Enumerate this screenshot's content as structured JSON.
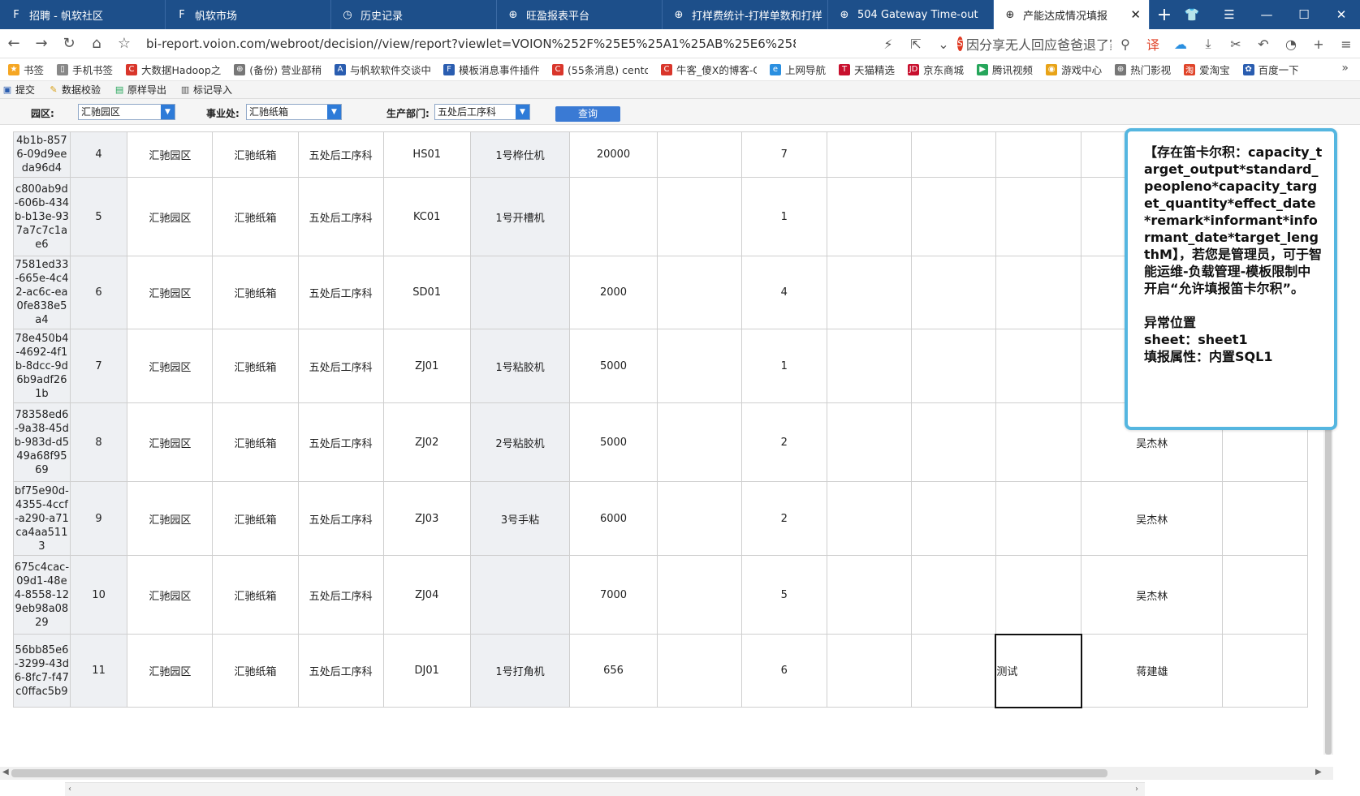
{
  "tabs": [
    {
      "label": "招聘 - 帆软社区",
      "icon": "F",
      "active": false
    },
    {
      "label": "帆软市场",
      "icon": "F",
      "active": false
    },
    {
      "label": "历史记录",
      "icon": "◷",
      "active": false
    },
    {
      "label": "旺盈报表平台",
      "icon": "⊕",
      "active": false
    },
    {
      "label": "打样费统计-打样单数和打样",
      "icon": "⊕",
      "active": false
    },
    {
      "label": "504 Gateway Time-out",
      "icon": "⊕",
      "active": false
    },
    {
      "label": "产能达成情况填报",
      "icon": "⊕",
      "active": true
    }
  ],
  "address": {
    "url": "bi-report.voion.com/webroot/decision//view/report?viewlet=VOION%252F%25E5%25A1%25AB%25E6%258A%25A5%",
    "news": "因分享无人回应爸爸退了家庭群"
  },
  "bookmarks": [
    {
      "label": "书签",
      "icon": "★",
      "color": "#f5a623"
    },
    {
      "label": "手机书签",
      "icon": "▯",
      "color": "#888888"
    },
    {
      "label": "大数据Hadoop之",
      "icon": "C",
      "color": "#d9362b"
    },
    {
      "label": "(备份) 营业部稍",
      "icon": "⊕",
      "color": "#777777"
    },
    {
      "label": "与帆软软件交谈中",
      "icon": "A",
      "color": "#2a5db0"
    },
    {
      "label": "模板消息事件插件",
      "icon": "F",
      "color": "#2a5db0"
    },
    {
      "label": "(55条消息) cento",
      "icon": "C",
      "color": "#d9362b"
    },
    {
      "label": "牛客_傻X的博客-C",
      "icon": "C",
      "color": "#d9362b"
    },
    {
      "label": "上网导航",
      "icon": "e",
      "color": "#2a8fe0"
    },
    {
      "label": "天猫精选",
      "icon": "T",
      "color": "#c8102e"
    },
    {
      "label": "京东商城",
      "icon": "JD",
      "color": "#c8102e"
    },
    {
      "label": "腾讯视频",
      "icon": "▶",
      "color": "#26a65b"
    },
    {
      "label": "游戏中心",
      "icon": "◉",
      "color": "#e8a317"
    },
    {
      "label": "热门影视",
      "icon": "⊕",
      "color": "#777777"
    },
    {
      "label": "爱淘宝",
      "icon": "淘",
      "color": "#e0442a"
    },
    {
      "label": "百度一下",
      "icon": "✿",
      "color": "#2a5db0"
    }
  ],
  "toolbar": {
    "submit": "提交",
    "validate": "数据校验",
    "export": "原样导出",
    "import": "标记导入"
  },
  "params": {
    "park_label": "园区:",
    "park_value": "汇驰园区",
    "division_label": "事业处:",
    "division_value": "汇驰纸箱",
    "dept_label": "生产部门:",
    "dept_value": "五处后工序科",
    "query_label": "查询"
  },
  "rows": [
    {
      "uuid": "4b1b-8576-09d9eeda96d4",
      "no": "4",
      "park": "汇驰园区",
      "division": "汇驰纸箱",
      "dept": "五处后工序科",
      "code": "HS01",
      "machine": "1号桦仕机",
      "target": "20000",
      "people": "7",
      "remark": "",
      "informant": ""
    },
    {
      "uuid": "c800ab9d-606b-434b-b13e-937a7c7c1ae6",
      "no": "5",
      "park": "汇驰园区",
      "division": "汇驰纸箱",
      "dept": "五处后工序科",
      "code": "KC01",
      "machine": "1号开槽机",
      "target": "",
      "people": "1",
      "remark": "",
      "informant": ""
    },
    {
      "uuid": "7581ed33-665e-4c42-ac6c-ea0fe838e5a4",
      "no": "6",
      "park": "汇驰园区",
      "division": "汇驰纸箱",
      "dept": "五处后工序科",
      "code": "SD01",
      "machine": "",
      "target": "2000",
      "people": "4",
      "remark": "",
      "informant": ""
    },
    {
      "uuid": "78e450b4-4692-4f1b-8dcc-9d6b9adf261b",
      "no": "7",
      "park": "汇驰园区",
      "division": "汇驰纸箱",
      "dept": "五处后工序科",
      "code": "ZJ01",
      "machine": "1号粘胶机",
      "target": "5000",
      "people": "1",
      "remark": "",
      "informant": ""
    },
    {
      "uuid": "78358ed6-9a38-45db-983d-d549a68f9569",
      "no": "8",
      "park": "汇驰园区",
      "division": "汇驰纸箱",
      "dept": "五处后工序科",
      "code": "ZJ02",
      "machine": "2号粘胶机",
      "target": "5000",
      "people": "2",
      "remark": "",
      "informant": "吴杰林"
    },
    {
      "uuid": "bf75e90d-4355-4ccf-a290-a71ca4aa5113",
      "no": "9",
      "park": "汇驰园区",
      "division": "汇驰纸箱",
      "dept": "五处后工序科",
      "code": "ZJ03",
      "machine": "3号手粘",
      "target": "6000",
      "people": "2",
      "remark": "",
      "informant": "吴杰林"
    },
    {
      "uuid": "675c4cac-09d1-48e4-8558-129eb98a0829",
      "no": "10",
      "park": "汇驰园区",
      "division": "汇驰纸箱",
      "dept": "五处后工序科",
      "code": "ZJ04",
      "machine": "",
      "target": "7000",
      "people": "5",
      "remark": "",
      "informant": "吴杰林"
    },
    {
      "uuid": "56bb85e6-3299-43d6-8fc7-f47c0ffac5b9",
      "no": "11",
      "park": "汇驰园区",
      "division": "汇驰纸箱",
      "dept": "五处后工序科",
      "code": "DJ01",
      "machine": "1号打角机",
      "target": "656",
      "people": "6",
      "remark": "测试",
      "informant": "蒋建雄"
    }
  ],
  "tooltip": {
    "message": "【存在笛卡尔积：capacity_target_output*standard_peopleno*capacity_target_quantity*effect_date*remark*informant*informant_date*target_lengthM】，若您是管理员，可于智能运维-负载管理-模板限制中开启“允许填报笛卡尔积”。",
    "location": "异常位置",
    "sheet": "sheet：sheet1",
    "attr": "填报属性：内置SQL1"
  }
}
